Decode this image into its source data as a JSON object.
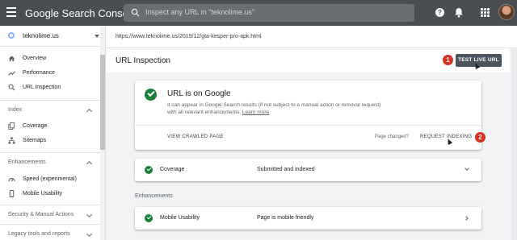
{
  "app": {
    "title": "Google Search Console",
    "search_placeholder": "Inspect any URL in \"teknolime.us\""
  },
  "sidebar": {
    "property": "teknolime.us",
    "items_top": [
      {
        "label": "Overview",
        "icon": "home-icon"
      },
      {
        "label": "Performance",
        "icon": "trending-up-icon"
      },
      {
        "label": "URL inspection",
        "icon": "search-icon",
        "active": true
      }
    ],
    "index_section": {
      "title": "Index",
      "items": [
        {
          "label": "Coverage",
          "icon": "file-copy-icon"
        },
        {
          "label": "Sitemaps",
          "icon": "sitemap-icon"
        }
      ]
    },
    "enhancements_section": {
      "title": "Enhancements",
      "items": [
        {
          "label": "Speed (experimental)",
          "icon": "speed-icon"
        },
        {
          "label": "Mobile Usability",
          "icon": "phone-icon"
        }
      ]
    },
    "security_section": {
      "title": "Security & Manual Actions"
    },
    "legacy_section": {
      "title": "Legacy tools and reports"
    }
  },
  "url_bar": {
    "url": "https://www.teknolime.us/2019/12/gta-kesper-pro-apk.html"
  },
  "page": {
    "title": "URL Inspection",
    "test_live_url": "TEST LIVE URL",
    "badge_1": "1",
    "badge_2": "2"
  },
  "status_card": {
    "title": "URL is on Google",
    "description": "It can appear in Google Search results (if not subject to a manual action or removal request) with all relevant enhancements.",
    "learn_more": "Learn more",
    "view_crawled": "VIEW CRAWLED PAGE",
    "page_changed": "Page changed?",
    "request_indexing": "REQUEST INDEXING"
  },
  "coverage_row": {
    "label": "Coverage",
    "value": "Submitted and indexed"
  },
  "enhancements_label": "Enhancements",
  "mobile_row": {
    "label": "Mobile Usability",
    "value": "Page is mobile friendly"
  },
  "colors": {
    "topbar": "#4a4e52",
    "success": "#188038",
    "badge": "#d93025",
    "button": "#4a5560"
  }
}
